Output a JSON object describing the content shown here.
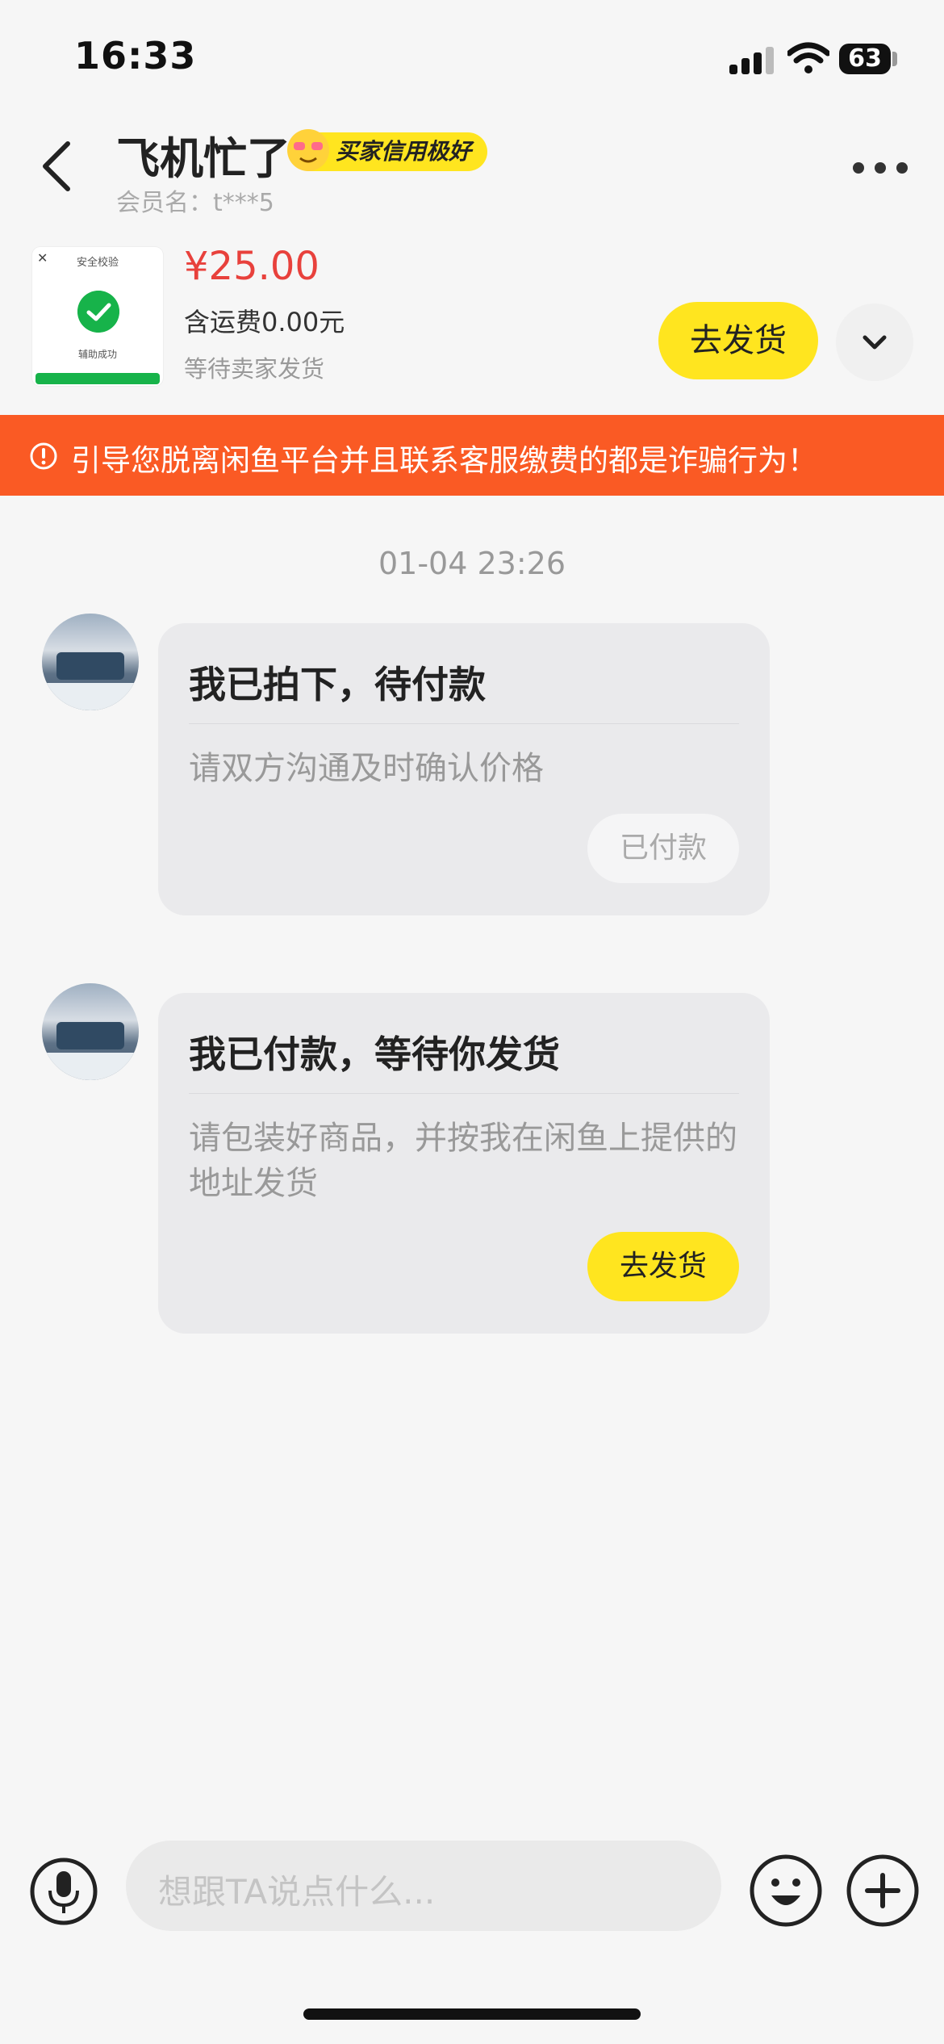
{
  "status_bar": {
    "time": "16:33",
    "battery": "63",
    "icons": [
      "signal-icon",
      "wifi-icon",
      "battery-icon"
    ]
  },
  "header": {
    "title": "飞机忙了",
    "badge": "买家信用极好",
    "member": "会员名：t***5",
    "icons": [
      "back-icon",
      "more-icon"
    ]
  },
  "product": {
    "thumb_title": "安全校验",
    "thumb_label": "辅助成功",
    "price": "¥25.00",
    "shipping": "含运费0.00元",
    "status": "等待卖家发货",
    "ship_button": "去发货"
  },
  "warning": {
    "text": "引导您脱离闲鱼平台并且联系客服缴费的都是诈骗行为！"
  },
  "chat": {
    "timestamp": "01-04 23:26",
    "messages": [
      {
        "title": "我已拍下，待付款",
        "text": "请双方沟通及时确认价格",
        "button": "已付款"
      },
      {
        "title": "我已付款，等待你发货",
        "text": "请包装好商品，并按我在闲鱼上提供的地址发货",
        "button": "去发货"
      }
    ]
  },
  "input_bar": {
    "placeholder": "想跟TA说点什么...",
    "icons": [
      "microphone-icon",
      "emoji-icon",
      "plus-icon"
    ]
  },
  "colors": {
    "accent_yellow": "#ffe51f",
    "warning_orange": "#fa5a24",
    "price_red": "#e8413c"
  }
}
